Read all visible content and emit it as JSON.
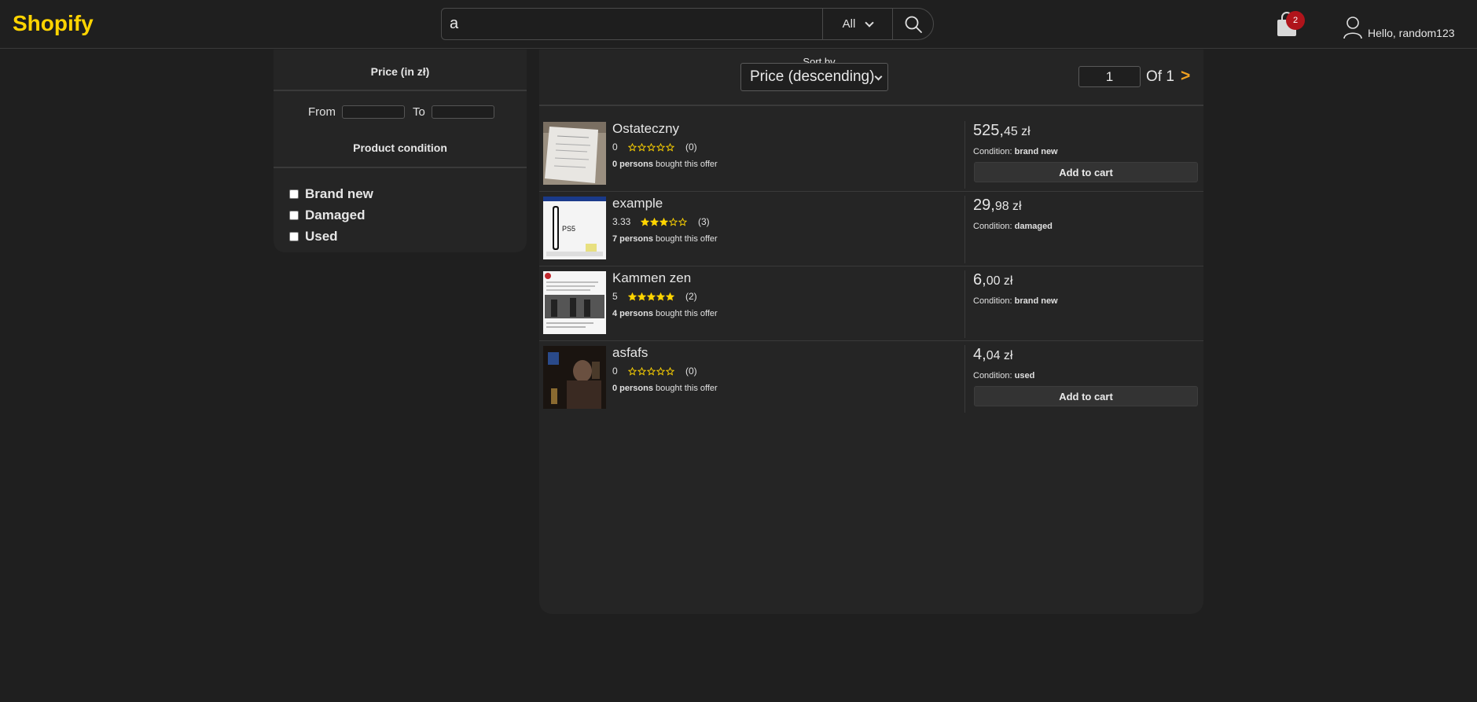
{
  "header": {
    "logo": "Shopify",
    "search_value": "a",
    "category": "All",
    "cart_count": "2",
    "greeting": "Hello, random123"
  },
  "filters": {
    "price_title": "Price (in zł)",
    "from_label": "From",
    "to_label": "To",
    "condition_title": "Product condition",
    "conditions": [
      "Brand new",
      "Damaged",
      "Used"
    ]
  },
  "toolbar": {
    "sort_label": "Sort by",
    "sort_value": "Price (descending)",
    "page_value": "1",
    "page_of": "Of 1",
    "next": ">"
  },
  "products": [
    {
      "title": "Ostateczny",
      "rating": "0",
      "stars_filled": 0,
      "reviews": "(0)",
      "bought_count": "0 persons",
      "bought_suffix": "bought this offer",
      "price_int": "525,",
      "price_dec": "45 zł",
      "condition_label": "Condition:",
      "condition": "brand new",
      "button": "Add to cart"
    },
    {
      "title": "example",
      "rating": "3.33",
      "stars_filled": 3,
      "reviews": "(3)",
      "bought_count": "7 persons",
      "bought_suffix": "bought this offer",
      "price_int": "29,",
      "price_dec": "98 zł",
      "condition_label": "Condition:",
      "condition": "damaged"
    },
    {
      "title": "Kammen zen",
      "rating": "5",
      "stars_filled": 5,
      "reviews": "(2)",
      "bought_count": "4 persons",
      "bought_suffix": "bought this offer",
      "price_int": "6,",
      "price_dec": "00 zł",
      "condition_label": "Condition:",
      "condition": "brand new"
    },
    {
      "title": "asfafs",
      "rating": "0",
      "stars_filled": 0,
      "reviews": "(0)",
      "bought_count": "0 persons",
      "bought_suffix": "bought this offer",
      "price_int": "4,",
      "price_dec": "04 zł",
      "condition_label": "Condition:",
      "condition": "used",
      "button": "Add to cart"
    }
  ],
  "colors": {
    "accent": "#ffd400",
    "star": "#ffd400",
    "next_arrow": "#f0a020",
    "badge": "#b0141b"
  }
}
